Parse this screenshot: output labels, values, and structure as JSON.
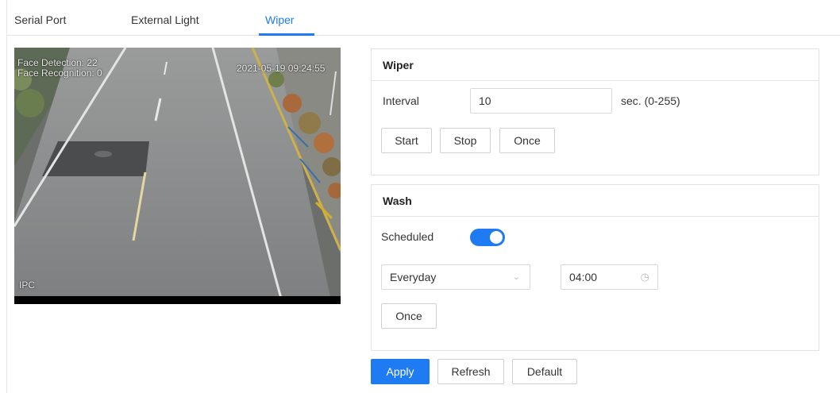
{
  "tabs": [
    {
      "label": "Serial Port",
      "active": false
    },
    {
      "label": "External Light",
      "active": false
    },
    {
      "label": "Wiper",
      "active": true
    }
  ],
  "video": {
    "osd_face_detection": "Face Detection: 22",
    "osd_face_recognition": "Face Recognition: 0",
    "osd_timestamp": "2021-05-19 09:24:55",
    "osd_channel": "IPC"
  },
  "wiper": {
    "title": "Wiper",
    "interval_label": "Interval",
    "interval_value": "10",
    "interval_hint": "sec. (0-255)",
    "start_label": "Start",
    "stop_label": "Stop",
    "once_label": "Once"
  },
  "wash": {
    "title": "Wash",
    "scheduled_label": "Scheduled",
    "scheduled_on": true,
    "frequency_value": "Everyday",
    "time_value": "04:00",
    "once_label": "Once"
  },
  "footer": {
    "apply_label": "Apply",
    "refresh_label": "Refresh",
    "default_label": "Default"
  },
  "colors": {
    "accent": "#1e7bf2",
    "border": "#e3e3e3"
  }
}
